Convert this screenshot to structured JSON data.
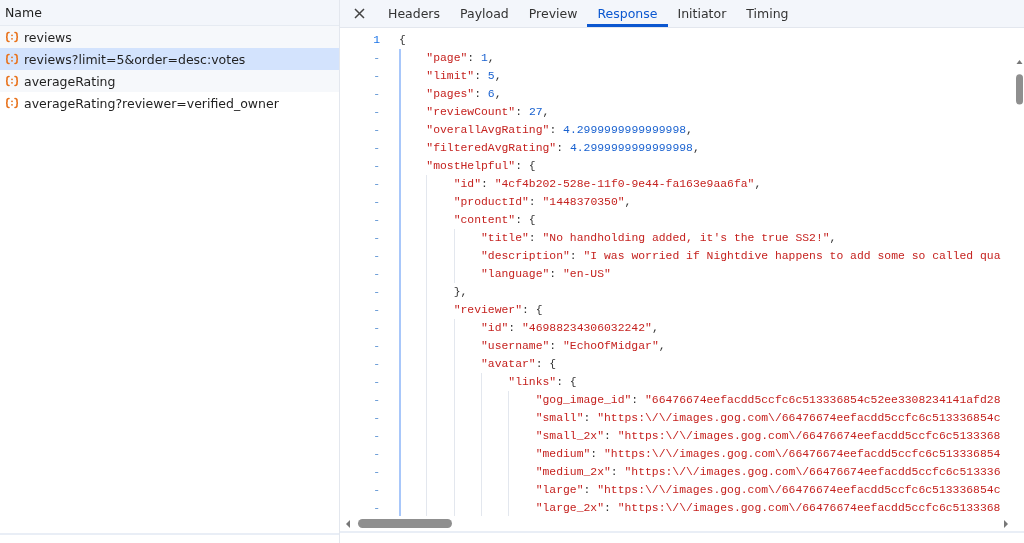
{
  "request_list": {
    "header": "Name",
    "items": [
      {
        "name": "reviews",
        "selected": false
      },
      {
        "name": "reviews?limit=5&order=desc:votes",
        "selected": true
      },
      {
        "name": "averageRating",
        "selected": false
      },
      {
        "name": "averageRating?reviewer=verified_owner",
        "selected": false
      }
    ]
  },
  "detail_tabs": [
    {
      "label": "Headers",
      "selected": false
    },
    {
      "label": "Payload",
      "selected": false
    },
    {
      "label": "Preview",
      "selected": false
    },
    {
      "label": "Response",
      "selected": true
    },
    {
      "label": "Initiator",
      "selected": false
    },
    {
      "label": "Timing",
      "selected": false
    }
  ],
  "response_lines": [
    {
      "gutter": "1",
      "tokens": [
        {
          "kind": "punct",
          "text": "{"
        }
      ],
      "children": [
        {
          "gutter": "-",
          "tokens": [
            {
              "kind": "key",
              "text": "\"page\""
            },
            {
              "kind": "punct",
              "text": ": "
            },
            {
              "kind": "number",
              "text": "1"
            },
            {
              "kind": "punct",
              "text": ","
            }
          ]
        },
        {
          "gutter": "-",
          "tokens": [
            {
              "kind": "key",
              "text": "\"limit\""
            },
            {
              "kind": "punct",
              "text": ": "
            },
            {
              "kind": "number",
              "text": "5"
            },
            {
              "kind": "punct",
              "text": ","
            }
          ]
        },
        {
          "gutter": "-",
          "tokens": [
            {
              "kind": "key",
              "text": "\"pages\""
            },
            {
              "kind": "punct",
              "text": ": "
            },
            {
              "kind": "number",
              "text": "6"
            },
            {
              "kind": "punct",
              "text": ","
            }
          ]
        },
        {
          "gutter": "-",
          "tokens": [
            {
              "kind": "key",
              "text": "\"reviewCount\""
            },
            {
              "kind": "punct",
              "text": ": "
            },
            {
              "kind": "number",
              "text": "27"
            },
            {
              "kind": "punct",
              "text": ","
            }
          ]
        },
        {
          "gutter": "-",
          "tokens": [
            {
              "kind": "key",
              "text": "\"overallAvgRating\""
            },
            {
              "kind": "punct",
              "text": ": "
            },
            {
              "kind": "number",
              "text": "4.2999999999999998"
            },
            {
              "kind": "punct",
              "text": ","
            }
          ]
        },
        {
          "gutter": "-",
          "tokens": [
            {
              "kind": "key",
              "text": "\"filteredAvgRating\""
            },
            {
              "kind": "punct",
              "text": ": "
            },
            {
              "kind": "number",
              "text": "4.2999999999999998"
            },
            {
              "kind": "punct",
              "text": ","
            }
          ]
        },
        {
          "gutter": "-",
          "tokens": [
            {
              "kind": "key",
              "text": "\"mostHelpful\""
            },
            {
              "kind": "punct",
              "text": ": {"
            }
          ],
          "children": [
            {
              "gutter": "-",
              "tokens": [
                {
                  "kind": "key",
                  "text": "\"id\""
                },
                {
                  "kind": "punct",
                  "text": ": "
                },
                {
                  "kind": "string",
                  "text": "\"4cf4b202-528e-11f0-9e44-fa163e9aa6fa\""
                },
                {
                  "kind": "punct",
                  "text": ","
                }
              ]
            },
            {
              "gutter": "-",
              "tokens": [
                {
                  "kind": "key",
                  "text": "\"productId\""
                },
                {
                  "kind": "punct",
                  "text": ": "
                },
                {
                  "kind": "string",
                  "text": "\"1448370350\""
                },
                {
                  "kind": "punct",
                  "text": ","
                }
              ]
            },
            {
              "gutter": "-",
              "tokens": [
                {
                  "kind": "key",
                  "text": "\"content\""
                },
                {
                  "kind": "punct",
                  "text": ": {"
                }
              ],
              "children": [
                {
                  "gutter": "-",
                  "tokens": [
                    {
                      "kind": "key",
                      "text": "\"title\""
                    },
                    {
                      "kind": "punct",
                      "text": ": "
                    },
                    {
                      "kind": "string",
                      "text": "\"No handholding added, it's the true SS2!\""
                    },
                    {
                      "kind": "punct",
                      "text": ","
                    }
                  ]
                },
                {
                  "gutter": "-",
                  "tokens": [
                    {
                      "kind": "key",
                      "text": "\"description\""
                    },
                    {
                      "kind": "punct",
                      "text": ": "
                    },
                    {
                      "kind": "string",
                      "text": "\"I was worried if Nightdive happens to add some so called qua"
                    }
                  ]
                },
                {
                  "gutter": "-",
                  "tokens": [
                    {
                      "kind": "key",
                      "text": "\"language\""
                    },
                    {
                      "kind": "punct",
                      "text": ": "
                    },
                    {
                      "kind": "string",
                      "text": "\"en-US\""
                    }
                  ]
                }
              ]
            },
            {
              "gutter": "-",
              "tokens": [
                {
                  "kind": "punct",
                  "text": "},"
                }
              ]
            },
            {
              "gutter": "-",
              "tokens": [
                {
                  "kind": "key",
                  "text": "\"reviewer\""
                },
                {
                  "kind": "punct",
                  "text": ": {"
                }
              ],
              "children": [
                {
                  "gutter": "-",
                  "tokens": [
                    {
                      "kind": "key",
                      "text": "\"id\""
                    },
                    {
                      "kind": "punct",
                      "text": ": "
                    },
                    {
                      "kind": "string",
                      "text": "\"46988234306032242\""
                    },
                    {
                      "kind": "punct",
                      "text": ","
                    }
                  ]
                },
                {
                  "gutter": "-",
                  "tokens": [
                    {
                      "kind": "key",
                      "text": "\"username\""
                    },
                    {
                      "kind": "punct",
                      "text": ": "
                    },
                    {
                      "kind": "string",
                      "text": "\"EchoOfMidgar\""
                    },
                    {
                      "kind": "punct",
                      "text": ","
                    }
                  ]
                },
                {
                  "gutter": "-",
                  "tokens": [
                    {
                      "kind": "key",
                      "text": "\"avatar\""
                    },
                    {
                      "kind": "punct",
                      "text": ": {"
                    }
                  ],
                  "children": [
                    {
                      "gutter": "-",
                      "tokens": [
                        {
                          "kind": "key",
                          "text": "\"links\""
                        },
                        {
                          "kind": "punct",
                          "text": ": {"
                        }
                      ],
                      "children": [
                        {
                          "gutter": "-",
                          "tokens": [
                            {
                              "kind": "key",
                              "text": "\"gog_image_id\""
                            },
                            {
                              "kind": "punct",
                              "text": ": "
                            },
                            {
                              "kind": "string",
                              "text": "\"66476674eefacdd5ccfc6c513336854c52ee3308234141afd28"
                            }
                          ]
                        },
                        {
                          "gutter": "-",
                          "tokens": [
                            {
                              "kind": "key",
                              "text": "\"small\""
                            },
                            {
                              "kind": "punct",
                              "text": ": "
                            },
                            {
                              "kind": "string",
                              "text": "\"https:\\/\\/images.gog.com\\/66476674eefacdd5ccfc6c513336854c"
                            }
                          ]
                        },
                        {
                          "gutter": "-",
                          "tokens": [
                            {
                              "kind": "key",
                              "text": "\"small_2x\""
                            },
                            {
                              "kind": "punct",
                              "text": ": "
                            },
                            {
                              "kind": "string",
                              "text": "\"https:\\/\\/images.gog.com\\/66476674eefacdd5ccfc6c5133368"
                            }
                          ]
                        },
                        {
                          "gutter": "-",
                          "tokens": [
                            {
                              "kind": "key",
                              "text": "\"medium\""
                            },
                            {
                              "kind": "punct",
                              "text": ": "
                            },
                            {
                              "kind": "string",
                              "text": "\"https:\\/\\/images.gog.com\\/66476674eefacdd5ccfc6c513336854"
                            }
                          ]
                        },
                        {
                          "gutter": "-",
                          "tokens": [
                            {
                              "kind": "key",
                              "text": "\"medium_2x\""
                            },
                            {
                              "kind": "punct",
                              "text": ": "
                            },
                            {
                              "kind": "string",
                              "text": "\"https:\\/\\/images.gog.com\\/66476674eefacdd5ccfc6c513336"
                            }
                          ]
                        },
                        {
                          "gutter": "-",
                          "tokens": [
                            {
                              "kind": "key",
                              "text": "\"large\""
                            },
                            {
                              "kind": "punct",
                              "text": ": "
                            },
                            {
                              "kind": "string",
                              "text": "\"https:\\/\\/images.gog.com\\/66476674eefacdd5ccfc6c513336854c"
                            }
                          ]
                        },
                        {
                          "gutter": "-",
                          "tokens": [
                            {
                              "kind": "key",
                              "text": "\"large_2x\""
                            },
                            {
                              "kind": "punct",
                              "text": ": "
                            },
                            {
                              "kind": "string",
                              "text": "\"https:\\/\\/images.gog.com\\/66476674eefacdd5ccfc6c5133368"
                            }
                          ]
                        }
                      ]
                    }
                  ]
                }
              ]
            }
          ]
        }
      ]
    }
  ]
}
